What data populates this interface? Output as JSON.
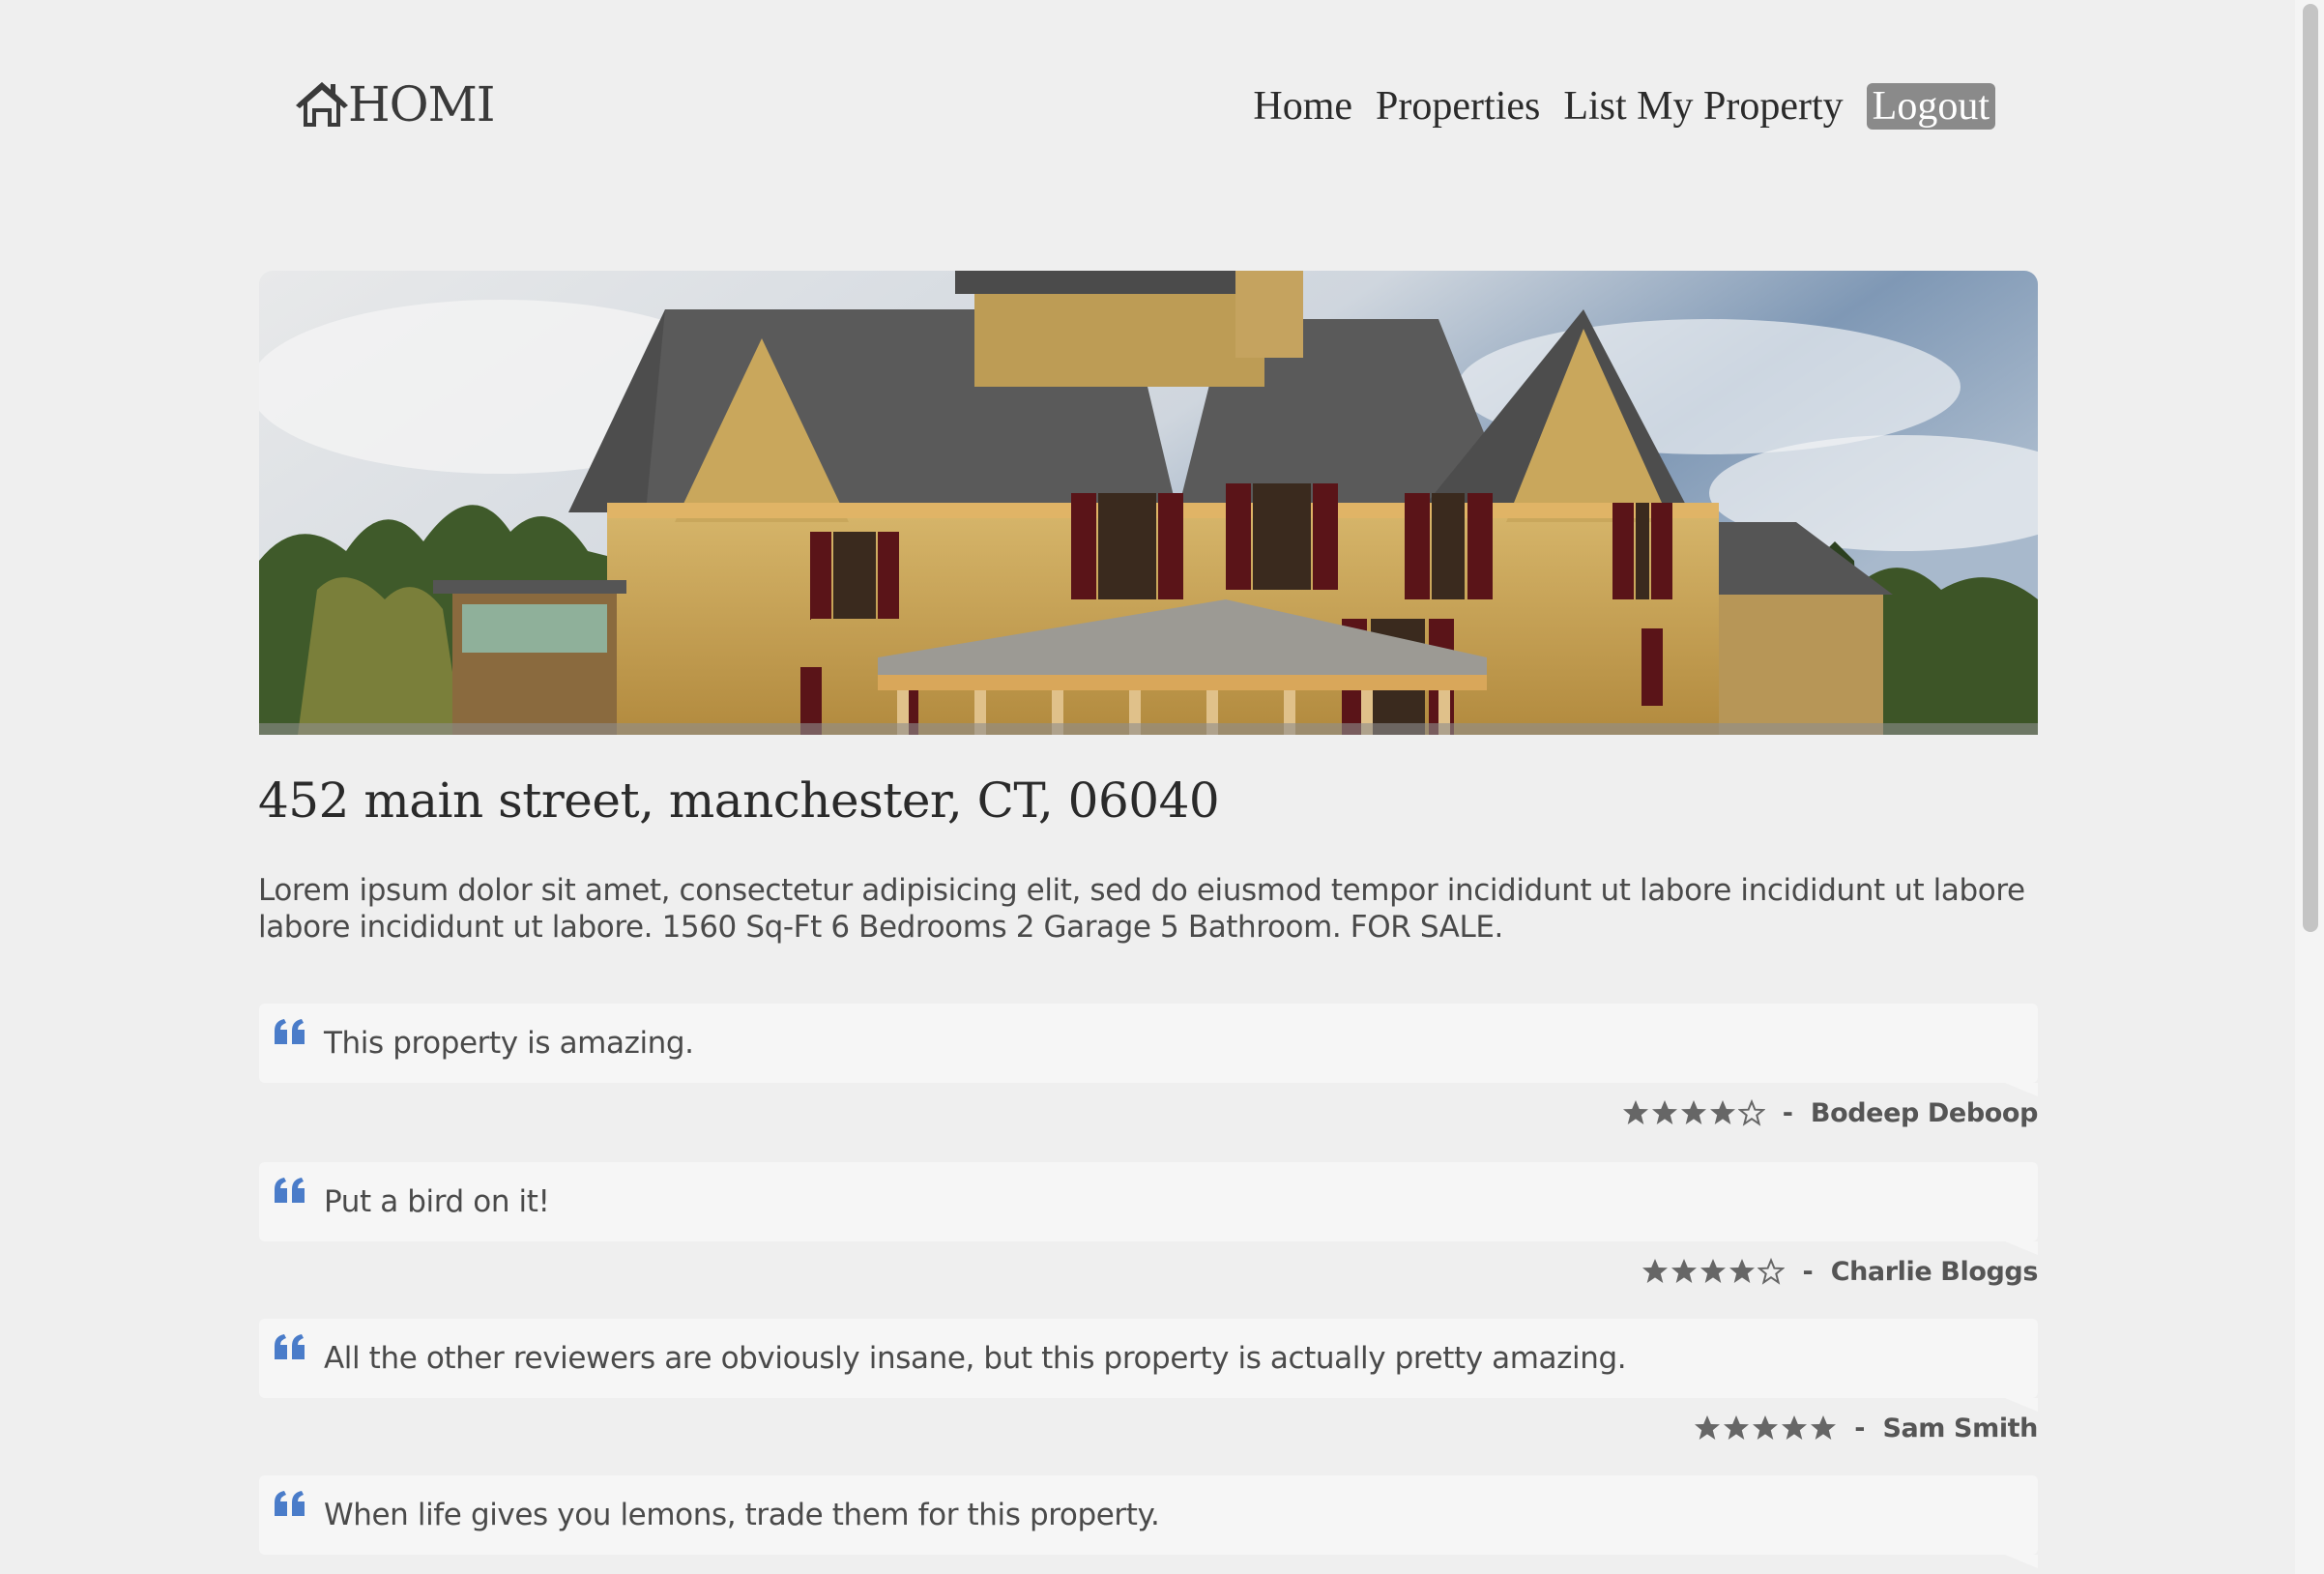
{
  "brand": {
    "name": "HOMI",
    "icon": "home-icon"
  },
  "nav": {
    "items": [
      {
        "label": "Home"
      },
      {
        "label": "Properties"
      },
      {
        "label": "List My Property"
      },
      {
        "label": "Logout",
        "active": true
      }
    ]
  },
  "hero": {
    "image": "victorian-house-photo"
  },
  "property": {
    "address": "452 main street, manchester, CT, 06040",
    "description": "Lorem ipsum dolor sit amet, consectetur adipisicing elit, sed do eiusmod tempor incididunt ut labore incididunt ut labore labore incididunt ut labore. 1560 Sq-Ft 6 Bedrooms 2 Garage 5 Bathroom. FOR SALE."
  },
  "reviews": [
    {
      "text": "This property is amazing.",
      "rating": 4,
      "max": 5,
      "separator": "-",
      "author": "Bodeep Deboop"
    },
    {
      "text": "Put a bird on it!",
      "rating": 4,
      "max": 5,
      "separator": "-",
      "author": "Charlie Bloggs"
    },
    {
      "text": "All the other reviewers are obviously insane, but this property is actually pretty amazing.",
      "rating": 5,
      "max": 5,
      "separator": "-",
      "author": "Sam Smith"
    },
    {
      "text": "When life gives you lemons, trade them for this property."
    }
  ],
  "colors": {
    "background": "#efefef",
    "accent_quote": "#4a7cc9",
    "nav_active": "#8a8a8a",
    "star": "#666666"
  }
}
